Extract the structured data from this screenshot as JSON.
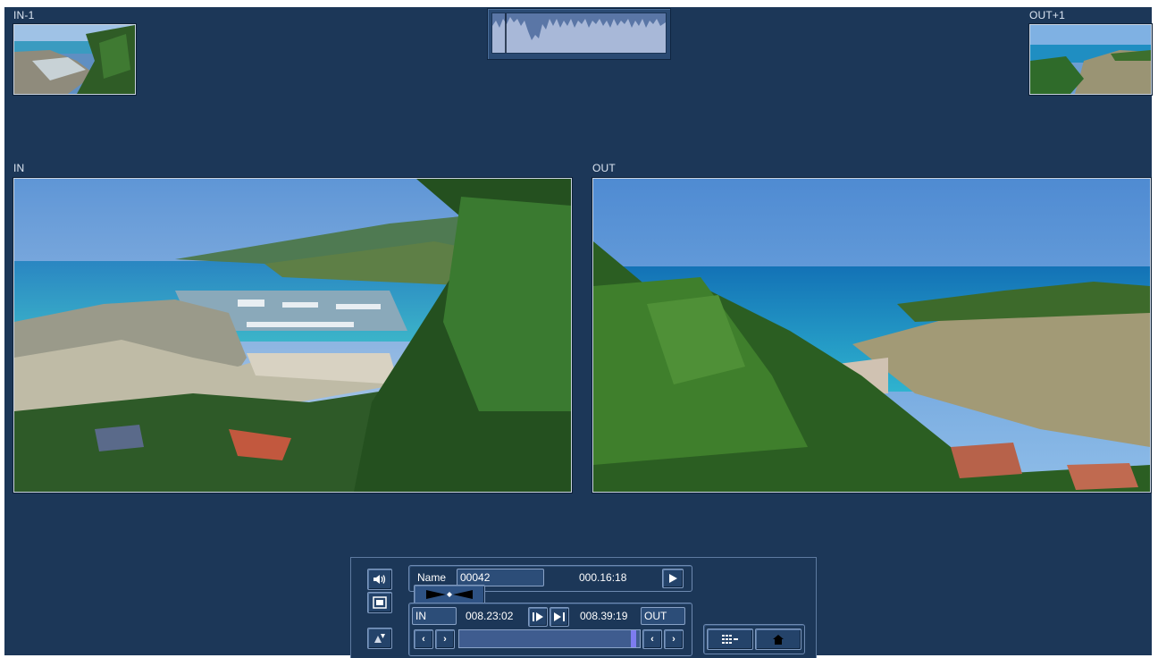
{
  "labels": {
    "in_minus_1": "IN-1",
    "out_plus_1": "OUT+1",
    "in": "IN",
    "out": "OUT"
  },
  "controls": {
    "name_label": "Name",
    "name_value": "00042",
    "duration": "000.16:18",
    "in_label": "IN",
    "in_time": "008.23:02",
    "out_time": "008.39:19",
    "out_label": "OUT",
    "play_icon": "play-icon",
    "scrub_position": 0.98
  },
  "colors": {
    "background": "#1c3758",
    "panel": "#1c3758",
    "button": "#24436a",
    "track": "#3f5c8f"
  }
}
